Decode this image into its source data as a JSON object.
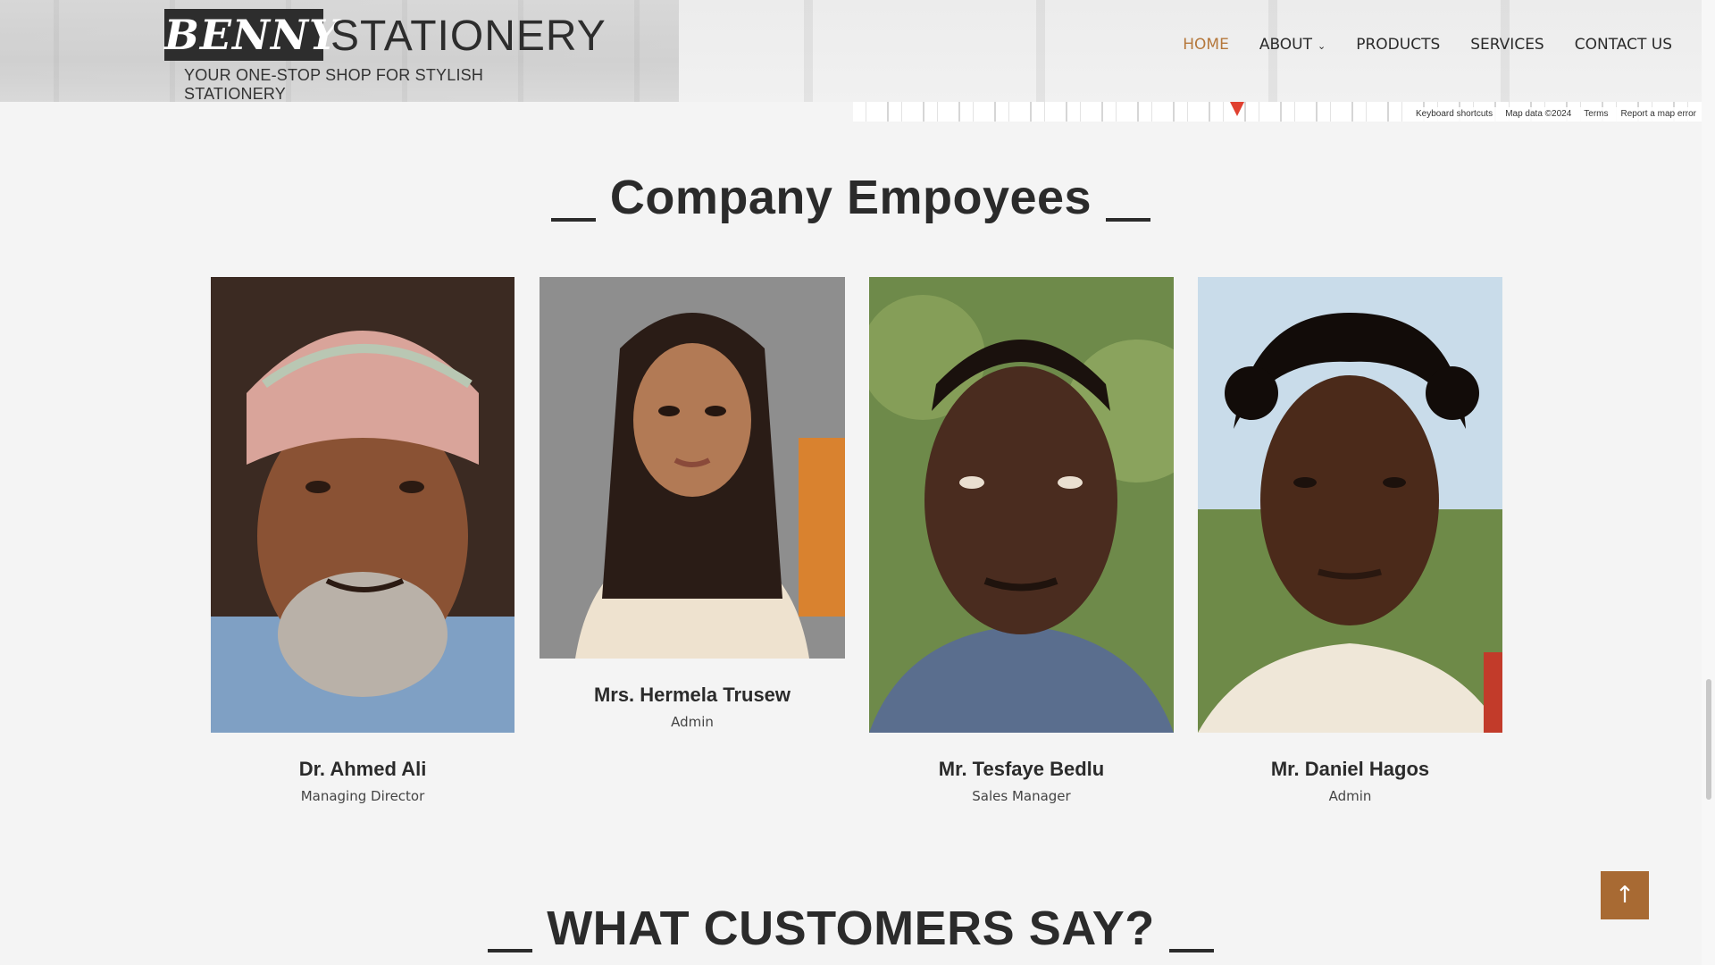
{
  "header": {
    "logo_mark": "BENNY",
    "logo_word": "STATIONERY",
    "tagline": "YOUR ONE-STOP SHOP FOR STYLISH STATIONERY",
    "nav": [
      {
        "label": "HOME",
        "active": true
      },
      {
        "label": "ABOUT",
        "has_dropdown": true
      },
      {
        "label": "PRODUCTS"
      },
      {
        "label": "SERVICES"
      },
      {
        "label": "CONTACT US"
      }
    ],
    "accent_color": "#b5783c"
  },
  "map": {
    "attribution": [
      "Keyboard shortcuts",
      "Map data ©2024",
      "Terms",
      "Report a map error"
    ]
  },
  "employees_section": {
    "title": "Company Empoyees",
    "members": [
      {
        "name": "Dr. Ahmed Ali",
        "role": "Managing Director",
        "icon": "portrait-older-man-turban"
      },
      {
        "name": "Mrs. Hermela Trusew",
        "role": "Admin",
        "icon": "portrait-woman-braids"
      },
      {
        "name": "Mr. Tesfaye Bedlu",
        "role": "Sales Manager",
        "icon": "portrait-man-short-hair"
      },
      {
        "name": "Mr. Daniel Hagos",
        "role": "Admin",
        "icon": "portrait-man-curly-hair"
      }
    ]
  },
  "testimonials_section": {
    "title": "WHAT CUSTOMERS SAY?"
  },
  "scroll_top": {
    "icon": "arrow-up-icon",
    "glyph": "↑",
    "color": "#a86a33"
  }
}
